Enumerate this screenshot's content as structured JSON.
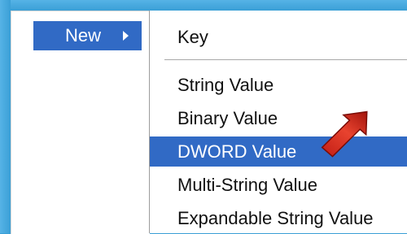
{
  "context_menu": {
    "new_item": {
      "label": "New"
    }
  },
  "submenu": {
    "items": [
      {
        "label": "Key"
      },
      {
        "label": "String Value"
      },
      {
        "label": "Binary Value"
      },
      {
        "label": "DWORD Value",
        "highlighted": true
      },
      {
        "label": "Multi-String Value"
      },
      {
        "label": "Expandable String Value"
      }
    ]
  },
  "colors": {
    "frame": "#3a9fd6",
    "highlight": "#316ac5",
    "annotation_arrow": "#d62a1e"
  },
  "icons": {
    "submenu_arrow": "chevron-right-icon",
    "annotation": "red-pointer-arrow-icon"
  }
}
